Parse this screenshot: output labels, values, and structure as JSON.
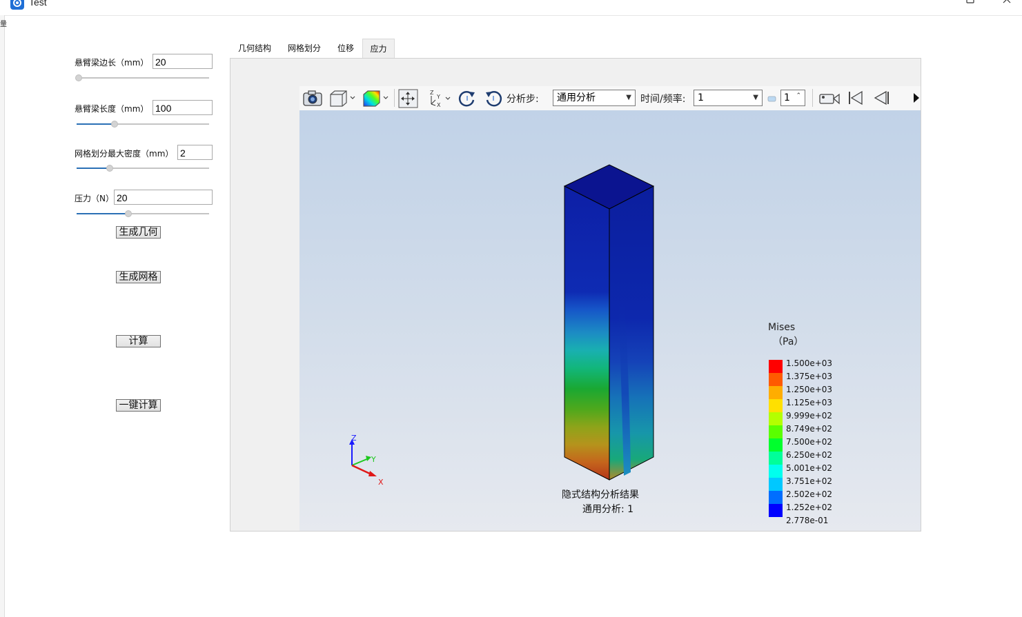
{
  "window": {
    "title": "Test"
  },
  "left_edge_char": "量",
  "params": [
    {
      "label": "悬臂梁边长（mm）",
      "value": "20",
      "slider_fraction": 0.0
    },
    {
      "label": "悬臂梁长度（mm）",
      "value": "100",
      "slider_fraction": 0.28
    },
    {
      "label": "网格划分最大密度（mm）",
      "value": "2",
      "slider_fraction": 0.24
    },
    {
      "label": "压力（N）",
      "value": "20",
      "slider_fraction": 0.38
    }
  ],
  "buttons": {
    "generate_geometry": "生成几何",
    "generate_mesh": "生成网格",
    "compute": "计算",
    "one_click_compute": "一键计算"
  },
  "tabs": [
    {
      "label": "几何结构",
      "active": false
    },
    {
      "label": "网格划分",
      "active": false
    },
    {
      "label": "位移",
      "active": false
    },
    {
      "label": "应力",
      "active": true
    }
  ],
  "toolbar": {
    "analysis_step_label": "分析步:",
    "analysis_step_value": "通用分析",
    "time_freq_label": "时间/频率:",
    "time_freq_value": "1",
    "frame_value": "1",
    "icons": [
      "camera-icon",
      "view-cube-icon",
      "contour-icon",
      "pan-icon",
      "axes-icon",
      "rotate-cw-icon",
      "rotate-ccw-icon",
      "video-icon",
      "first-frame-icon",
      "previous-frame-icon",
      "next-icon"
    ]
  },
  "legend": {
    "title": "Mises",
    "unit": "（Pa）",
    "entries": [
      {
        "label": "1.500e+03",
        "color": "#ff0000"
      },
      {
        "label": "1.375e+03",
        "color": "#ff5a00"
      },
      {
        "label": "1.250e+03",
        "color": "#ffad00"
      },
      {
        "label": "1.125e+03",
        "color": "#ffe000"
      },
      {
        "label": "9.999e+02",
        "color": "#b4ff00"
      },
      {
        "label": "8.749e+02",
        "color": "#5aff00"
      },
      {
        "label": "7.500e+02",
        "color": "#00ff2d"
      },
      {
        "label": "6.250e+02",
        "color": "#00ff9a"
      },
      {
        "label": "5.001e+02",
        "color": "#00ffee"
      },
      {
        "label": "3.751e+02",
        "color": "#00c8ff"
      },
      {
        "label": "2.502e+02",
        "color": "#006eff"
      },
      {
        "label": "1.252e+02",
        "color": "#0000ff"
      },
      {
        "label": "2.778e-01",
        "color": ""
      }
    ]
  },
  "result": {
    "title": "隐式结构分析结果",
    "subtitle": "通用分析: 1"
  },
  "triad": {
    "x": "X",
    "y": "Y",
    "z": "Z"
  }
}
